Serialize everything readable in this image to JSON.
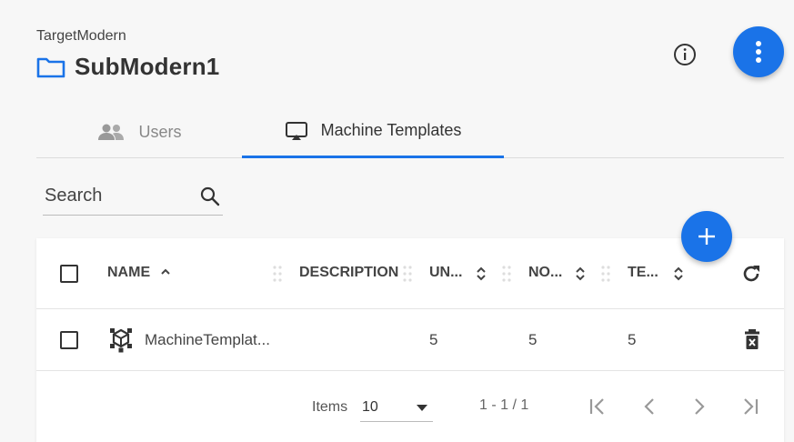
{
  "header": {
    "breadcrumb": "TargetModern",
    "title": "SubModern1"
  },
  "colors": {
    "accent": "#1a73e8"
  },
  "tabs": [
    {
      "label": "Users",
      "icon": "users-icon",
      "active": false
    },
    {
      "label": "Machine Templates",
      "icon": "monitor-icon",
      "active": true
    }
  ],
  "search": {
    "placeholder": "Search",
    "value": ""
  },
  "table": {
    "columns": [
      {
        "label": "NAME",
        "sort": "asc"
      },
      {
        "label": "DESCRIPTION",
        "sort": "none"
      },
      {
        "label": "UN...",
        "sort": "both"
      },
      {
        "label": "NO...",
        "sort": "both"
      },
      {
        "label": "TE...",
        "sort": "both"
      }
    ],
    "rows": [
      {
        "name": "MachineTemplat...",
        "description": "",
        "un": "5",
        "no": "5",
        "te": "5"
      }
    ]
  },
  "pagination": {
    "items_label": "Items",
    "page_size": "10",
    "range": "1 - 1 / 1"
  }
}
